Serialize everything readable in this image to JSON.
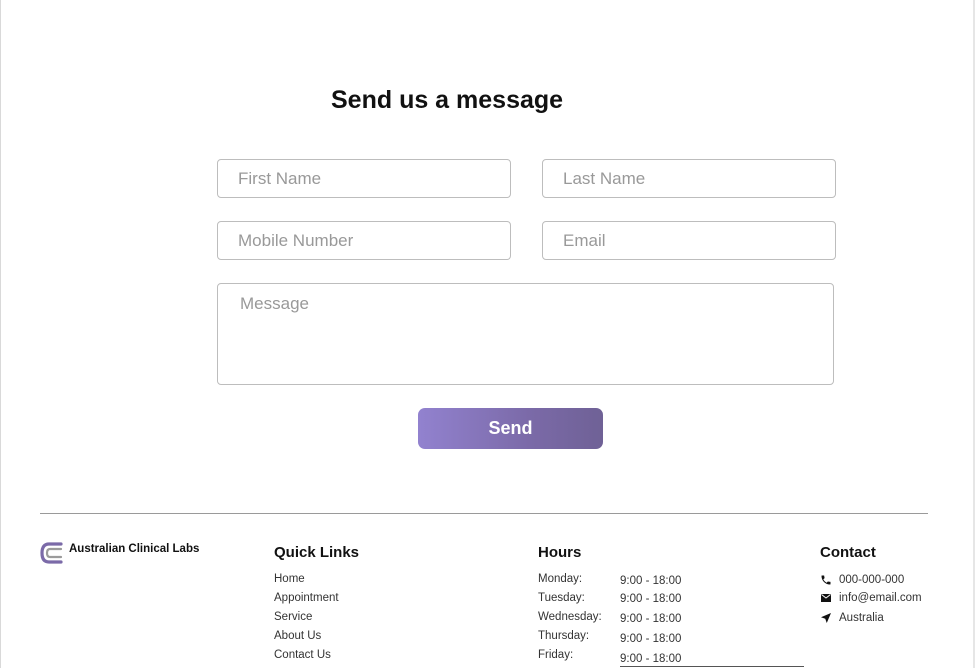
{
  "form": {
    "title": "Send us a message",
    "first_name_placeholder": "First Name",
    "last_name_placeholder": "Last Name",
    "mobile_placeholder": "Mobile Number",
    "email_placeholder": "Email",
    "message_placeholder": "Message",
    "send_label": "Send",
    "button_gradient": [
      "#9282cf",
      "#6f6196"
    ]
  },
  "footer": {
    "logo_text": "Australian Clinical Labs",
    "logo_color": "#7b6aa8",
    "quick_links": {
      "title": "Quick Links",
      "items": [
        "Home",
        "Appointment",
        "Service",
        "About Us",
        "Contact Us"
      ]
    },
    "hours": {
      "title": "Hours",
      "rows": [
        {
          "day": "Monday:",
          "time": "9:00 - 18:00"
        },
        {
          "day": "Tuesday:",
          "time": "9:00 - 18:00"
        },
        {
          "day": "Wednesday:",
          "time": "9:00 - 18:00"
        },
        {
          "day": "Thursday:",
          "time": "9:00 - 18:00"
        },
        {
          "day": "Friday:",
          "time": "9:00 - 18:00"
        }
      ]
    },
    "contact": {
      "title": "Contact",
      "phone": "000-000-000",
      "phone_icon": "phone-icon",
      "email": "info@email.com",
      "email_icon": "envelope-icon",
      "location": "Australia",
      "location_icon": "location-arrow-icon"
    }
  }
}
